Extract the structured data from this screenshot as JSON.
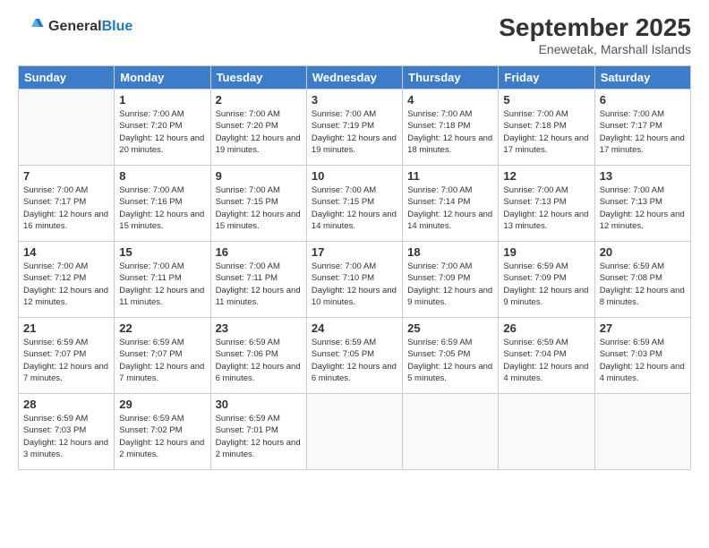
{
  "header": {
    "logo_general": "General",
    "logo_blue": "Blue",
    "month": "September 2025",
    "location": "Enewetak, Marshall Islands"
  },
  "days_of_week": [
    "Sunday",
    "Monday",
    "Tuesday",
    "Wednesday",
    "Thursday",
    "Friday",
    "Saturday"
  ],
  "weeks": [
    [
      null,
      {
        "date": "1",
        "sunrise": "7:00 AM",
        "sunset": "7:20 PM",
        "daylight": "12 hours and 20 minutes."
      },
      {
        "date": "2",
        "sunrise": "7:00 AM",
        "sunset": "7:20 PM",
        "daylight": "12 hours and 19 minutes."
      },
      {
        "date": "3",
        "sunrise": "7:00 AM",
        "sunset": "7:19 PM",
        "daylight": "12 hours and 19 minutes."
      },
      {
        "date": "4",
        "sunrise": "7:00 AM",
        "sunset": "7:18 PM",
        "daylight": "12 hours and 18 minutes."
      },
      {
        "date": "5",
        "sunrise": "7:00 AM",
        "sunset": "7:18 PM",
        "daylight": "12 hours and 17 minutes."
      },
      {
        "date": "6",
        "sunrise": "7:00 AM",
        "sunset": "7:17 PM",
        "daylight": "12 hours and 17 minutes."
      }
    ],
    [
      {
        "date": "7",
        "sunrise": "7:00 AM",
        "sunset": "7:17 PM",
        "daylight": "12 hours and 16 minutes."
      },
      {
        "date": "8",
        "sunrise": "7:00 AM",
        "sunset": "7:16 PM",
        "daylight": "12 hours and 15 minutes."
      },
      {
        "date": "9",
        "sunrise": "7:00 AM",
        "sunset": "7:15 PM",
        "daylight": "12 hours and 15 minutes."
      },
      {
        "date": "10",
        "sunrise": "7:00 AM",
        "sunset": "7:15 PM",
        "daylight": "12 hours and 14 minutes."
      },
      {
        "date": "11",
        "sunrise": "7:00 AM",
        "sunset": "7:14 PM",
        "daylight": "12 hours and 14 minutes."
      },
      {
        "date": "12",
        "sunrise": "7:00 AM",
        "sunset": "7:13 PM",
        "daylight": "12 hours and 13 minutes."
      },
      {
        "date": "13",
        "sunrise": "7:00 AM",
        "sunset": "7:13 PM",
        "daylight": "12 hours and 12 minutes."
      }
    ],
    [
      {
        "date": "14",
        "sunrise": "7:00 AM",
        "sunset": "7:12 PM",
        "daylight": "12 hours and 12 minutes."
      },
      {
        "date": "15",
        "sunrise": "7:00 AM",
        "sunset": "7:11 PM",
        "daylight": "12 hours and 11 minutes."
      },
      {
        "date": "16",
        "sunrise": "7:00 AM",
        "sunset": "7:11 PM",
        "daylight": "12 hours and 11 minutes."
      },
      {
        "date": "17",
        "sunrise": "7:00 AM",
        "sunset": "7:10 PM",
        "daylight": "12 hours and 10 minutes."
      },
      {
        "date": "18",
        "sunrise": "7:00 AM",
        "sunset": "7:09 PM",
        "daylight": "12 hours and 9 minutes."
      },
      {
        "date": "19",
        "sunrise": "6:59 AM",
        "sunset": "7:09 PM",
        "daylight": "12 hours and 9 minutes."
      },
      {
        "date": "20",
        "sunrise": "6:59 AM",
        "sunset": "7:08 PM",
        "daylight": "12 hours and 8 minutes."
      }
    ],
    [
      {
        "date": "21",
        "sunrise": "6:59 AM",
        "sunset": "7:07 PM",
        "daylight": "12 hours and 7 minutes."
      },
      {
        "date": "22",
        "sunrise": "6:59 AM",
        "sunset": "7:07 PM",
        "daylight": "12 hours and 7 minutes."
      },
      {
        "date": "23",
        "sunrise": "6:59 AM",
        "sunset": "7:06 PM",
        "daylight": "12 hours and 6 minutes."
      },
      {
        "date": "24",
        "sunrise": "6:59 AM",
        "sunset": "7:05 PM",
        "daylight": "12 hours and 6 minutes."
      },
      {
        "date": "25",
        "sunrise": "6:59 AM",
        "sunset": "7:05 PM",
        "daylight": "12 hours and 5 minutes."
      },
      {
        "date": "26",
        "sunrise": "6:59 AM",
        "sunset": "7:04 PM",
        "daylight": "12 hours and 4 minutes."
      },
      {
        "date": "27",
        "sunrise": "6:59 AM",
        "sunset": "7:03 PM",
        "daylight": "12 hours and 4 minutes."
      }
    ],
    [
      {
        "date": "28",
        "sunrise": "6:59 AM",
        "sunset": "7:03 PM",
        "daylight": "12 hours and 3 minutes."
      },
      {
        "date": "29",
        "sunrise": "6:59 AM",
        "sunset": "7:02 PM",
        "daylight": "12 hours and 2 minutes."
      },
      {
        "date": "30",
        "sunrise": "6:59 AM",
        "sunset": "7:01 PM",
        "daylight": "12 hours and 2 minutes."
      },
      null,
      null,
      null,
      null
    ]
  ]
}
